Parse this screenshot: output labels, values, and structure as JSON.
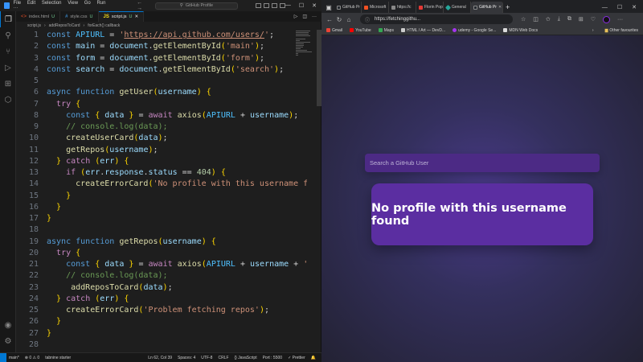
{
  "vscode": {
    "menu": [
      "File",
      "Edit",
      "Selection",
      "View",
      "Go",
      "Run"
    ],
    "more": "···",
    "search_label": "GitHub Profile",
    "tabs": [
      {
        "icon": "<>",
        "name": "index.html",
        "badge": "U"
      },
      {
        "icon": "#",
        "name": "style.css",
        "badge": "U"
      },
      {
        "icon": "JS",
        "name": "script.js",
        "badge": "U",
        "active": true
      }
    ],
    "breadcrumb": [
      "script.js",
      "addReposToCard",
      "forEach() callback"
    ],
    "code": [
      "const APIURL = 'https://api.github.com/users/';",
      "const main = document.getElementById('main');",
      "const form = document.getElementById('form');",
      "const search = document.getElementById('search');",
      "",
      "async function getUser(username) {",
      "  try {",
      "    const { data } = await axios(APIURL + username);",
      "    // console.log(data);",
      "    createUserCard(data);",
      "    getRepos(username);",
      "  } catch (err) {",
      "    if (err.response.status == 404) {",
      "      createErrorCard('No profile with this username f",
      "    }",
      "  }",
      "}",
      "",
      "async function getRepos(username) {",
      "  try {",
      "    const { data } = await axios(APIURL + username + '",
      "    // console.log(data);",
      "     addReposToCard(data);",
      "  } catch (err) {",
      "    createErrorCard('Problem fetching repos');",
      "  }",
      "}",
      ""
    ],
    "status": {
      "branch": "main*",
      "problems": "⊗ 0 ⚠ 0",
      "tabnine": "tabnine starter",
      "position": "Ln 62, Col 39",
      "spaces": "Spaces: 4",
      "encoding": "UTF-8",
      "eol": "CRLF",
      "language": "{} JavaScript",
      "port": "Port : 5500",
      "prettier": "✓ Prettier"
    }
  },
  "browser": {
    "tabs": [
      {
        "label": "GitHub Pr",
        "color": "#24292f"
      },
      {
        "label": "Microsoft",
        "color": "#f25022"
      },
      {
        "label": "https://c",
        "color": "#888888"
      },
      {
        "label": "Florin Pop",
        "color": "#e53935"
      },
      {
        "label": "General",
        "color": "#26a69a"
      },
      {
        "label": "GitHub Pr",
        "color": "#24292f",
        "active": true
      }
    ],
    "url": "https://fetchinggithu...",
    "bookmarks": [
      {
        "label": "Gmail",
        "color": "#ea4335"
      },
      {
        "label": "YouTube",
        "color": "#ff0000"
      },
      {
        "label": "Maps",
        "color": "#34a853"
      },
      {
        "label": "HTML / Art — DevD...",
        "color": "#cccccc"
      },
      {
        "label": "udemy - Google Se...",
        "color": "#a435f0"
      },
      {
        "label": "MDN Web Docs",
        "color": "#dddddd"
      }
    ],
    "other_favourites": "Other favourites",
    "search_placeholder": "Search a GitHub User",
    "error_message": "No profile with this username found"
  },
  "colors": {
    "vscode_bg": "#1e1e1e",
    "accent": "#0078d4",
    "card_bg": "#5b2ea1",
    "page_bg": "#34305e"
  }
}
